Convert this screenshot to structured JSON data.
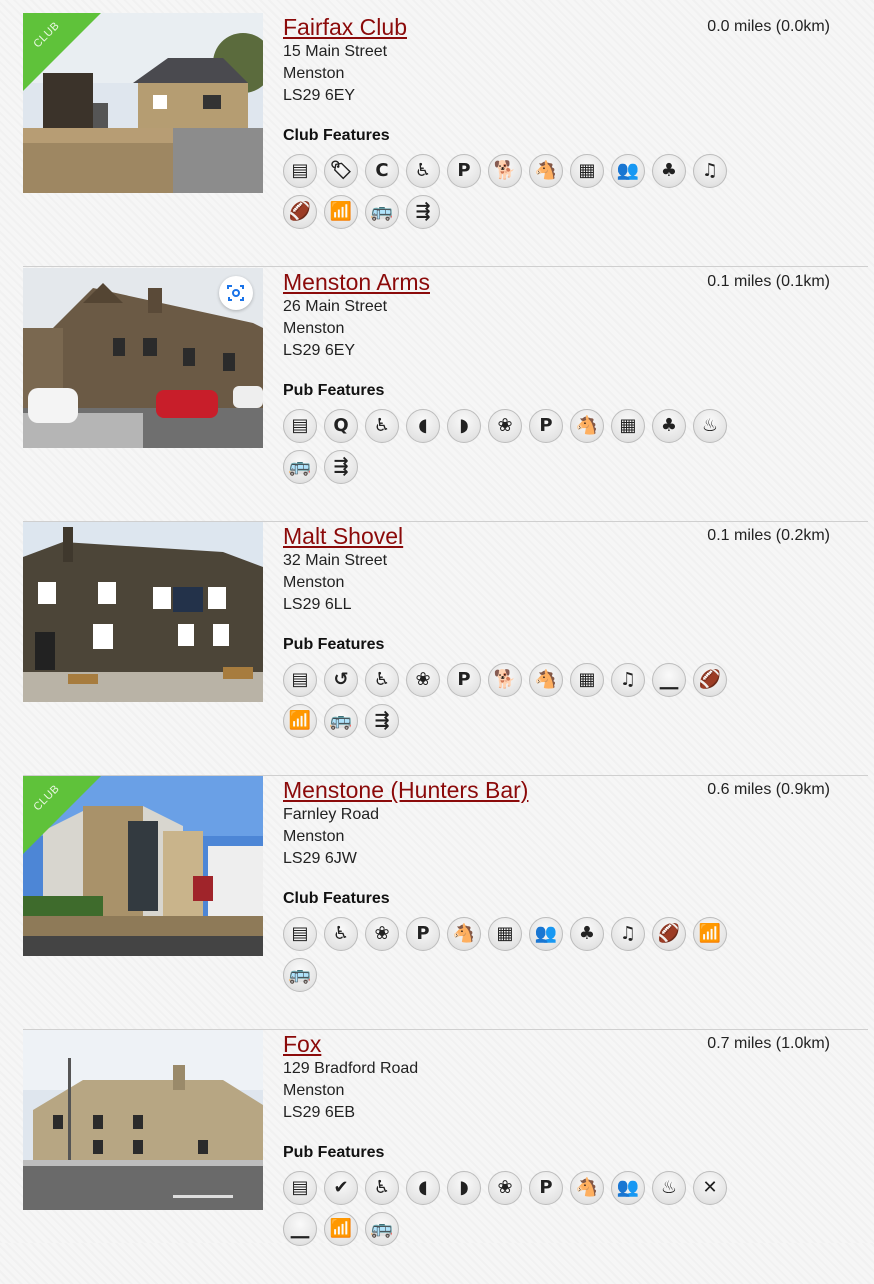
{
  "listings": [
    {
      "name": "Fairfax Club",
      "street": "15 Main Street",
      "town": "Menston",
      "postcode": "LS29 6EY",
      "distance": "0.0 miles (0.0km)",
      "features_title": "Club Features",
      "club_badge": "CLUB",
      "icons": [
        {
          "name": "cask-ale-icon",
          "glyph": "▤"
        },
        {
          "name": "price-tag-icon",
          "glyph": "🏷"
        },
        {
          "name": "camra-icon",
          "glyph": "C"
        },
        {
          "name": "wheelchair-icon",
          "glyph": "♿"
        },
        {
          "name": "parking-icon",
          "glyph": "P"
        },
        {
          "name": "dog-friendly-icon",
          "glyph": "🐕"
        },
        {
          "name": "family-friendly-icon",
          "glyph": "🐴"
        },
        {
          "name": "events-calendar-icon",
          "glyph": "▦"
        },
        {
          "name": "function-room-icon",
          "glyph": "👥"
        },
        {
          "name": "games-icon",
          "glyph": "♣"
        },
        {
          "name": "live-music-icon",
          "glyph": "♫"
        },
        {
          "name": "sports-tv-icon",
          "glyph": "🏈"
        },
        {
          "name": "wifi-icon",
          "glyph": "📶"
        },
        {
          "name": "bus-icon",
          "glyph": "🚌"
        },
        {
          "name": "train-icon",
          "glyph": "⇶"
        }
      ]
    },
    {
      "name": "Menston Arms",
      "street": "26 Main Street",
      "town": "Menston",
      "postcode": "LS29 6EY",
      "distance": "0.1 miles (0.1km)",
      "features_title": "Pub Features",
      "icons": [
        {
          "name": "cask-ale-icon",
          "glyph": "▤"
        },
        {
          "name": "cask-marque-icon",
          "glyph": "Q"
        },
        {
          "name": "wheelchair-icon",
          "glyph": "♿"
        },
        {
          "name": "lunchtime-meals-icon",
          "glyph": "◖"
        },
        {
          "name": "evening-meals-icon",
          "glyph": "◗"
        },
        {
          "name": "garden-icon",
          "glyph": "❀"
        },
        {
          "name": "parking-icon",
          "glyph": "P"
        },
        {
          "name": "family-friendly-icon",
          "glyph": "🐴"
        },
        {
          "name": "events-calendar-icon",
          "glyph": "▦"
        },
        {
          "name": "games-icon",
          "glyph": "♣"
        },
        {
          "name": "real-fire-icon",
          "glyph": "♨"
        },
        {
          "name": "bus-icon",
          "glyph": "🚌"
        },
        {
          "name": "train-icon",
          "glyph": "⇶"
        }
      ]
    },
    {
      "name": "Malt Shovel",
      "street": "32 Main Street",
      "town": "Menston",
      "postcode": "LS29 6LL",
      "distance": "0.1 miles (0.2km)",
      "features_title": "Pub Features",
      "icons": [
        {
          "name": "cask-ale-icon",
          "glyph": "▤"
        },
        {
          "name": "rotating-beers-icon",
          "glyph": "↺"
        },
        {
          "name": "wheelchair-icon",
          "glyph": "♿"
        },
        {
          "name": "garden-icon",
          "glyph": "❀"
        },
        {
          "name": "parking-icon",
          "glyph": "P"
        },
        {
          "name": "dog-friendly-icon",
          "glyph": "🐕"
        },
        {
          "name": "family-friendly-icon",
          "glyph": "🐴"
        },
        {
          "name": "events-calendar-icon",
          "glyph": "▦"
        },
        {
          "name": "live-music-icon",
          "glyph": "♫"
        },
        {
          "name": "smoking-area-icon",
          "glyph": "⎽"
        },
        {
          "name": "sports-tv-icon",
          "glyph": "🏈"
        },
        {
          "name": "wifi-icon",
          "glyph": "📶"
        },
        {
          "name": "bus-icon",
          "glyph": "🚌"
        },
        {
          "name": "train-icon",
          "glyph": "⇶"
        }
      ]
    },
    {
      "name": "Menstone (Hunters Bar)",
      "street": "Farnley Road",
      "town": "Menston",
      "postcode": "LS29 6JW",
      "distance": "0.6 miles (0.9km)",
      "features_title": "Club Features",
      "club_badge": "CLUB",
      "icons": [
        {
          "name": "cask-ale-icon",
          "glyph": "▤"
        },
        {
          "name": "wheelchair-icon",
          "glyph": "♿"
        },
        {
          "name": "garden-icon",
          "glyph": "❀"
        },
        {
          "name": "parking-icon",
          "glyph": "P"
        },
        {
          "name": "family-friendly-icon",
          "glyph": "🐴"
        },
        {
          "name": "events-calendar-icon",
          "glyph": "▦"
        },
        {
          "name": "function-room-icon",
          "glyph": "👥"
        },
        {
          "name": "games-icon",
          "glyph": "♣"
        },
        {
          "name": "live-music-icon",
          "glyph": "♫"
        },
        {
          "name": "sports-tv-icon",
          "glyph": "🏈"
        },
        {
          "name": "wifi-icon",
          "glyph": "📶"
        },
        {
          "name": "bus-icon",
          "glyph": "🚌"
        }
      ]
    },
    {
      "name": "Fox",
      "street": "129 Bradford Road",
      "town": "Menston",
      "postcode": "LS29 6EB",
      "distance": "0.7 miles (1.0km)",
      "features_title": "Pub Features",
      "icons": [
        {
          "name": "cask-ale-icon",
          "glyph": "▤"
        },
        {
          "name": "lgbt-friendly-icon",
          "glyph": "✔"
        },
        {
          "name": "wheelchair-icon",
          "glyph": "♿"
        },
        {
          "name": "lunchtime-meals-icon",
          "glyph": "◖"
        },
        {
          "name": "evening-meals-icon",
          "glyph": "◗"
        },
        {
          "name": "garden-icon",
          "glyph": "❀"
        },
        {
          "name": "parking-icon",
          "glyph": "P"
        },
        {
          "name": "family-friendly-icon",
          "glyph": "🐴"
        },
        {
          "name": "function-room-icon",
          "glyph": "👥"
        },
        {
          "name": "real-fire-icon",
          "glyph": "♨"
        },
        {
          "name": "no-food-icon",
          "glyph": "✕"
        },
        {
          "name": "smoking-area-icon",
          "glyph": "⎽"
        },
        {
          "name": "wifi-icon",
          "glyph": "📶"
        },
        {
          "name": "bus-icon",
          "glyph": "🚌"
        }
      ]
    }
  ]
}
